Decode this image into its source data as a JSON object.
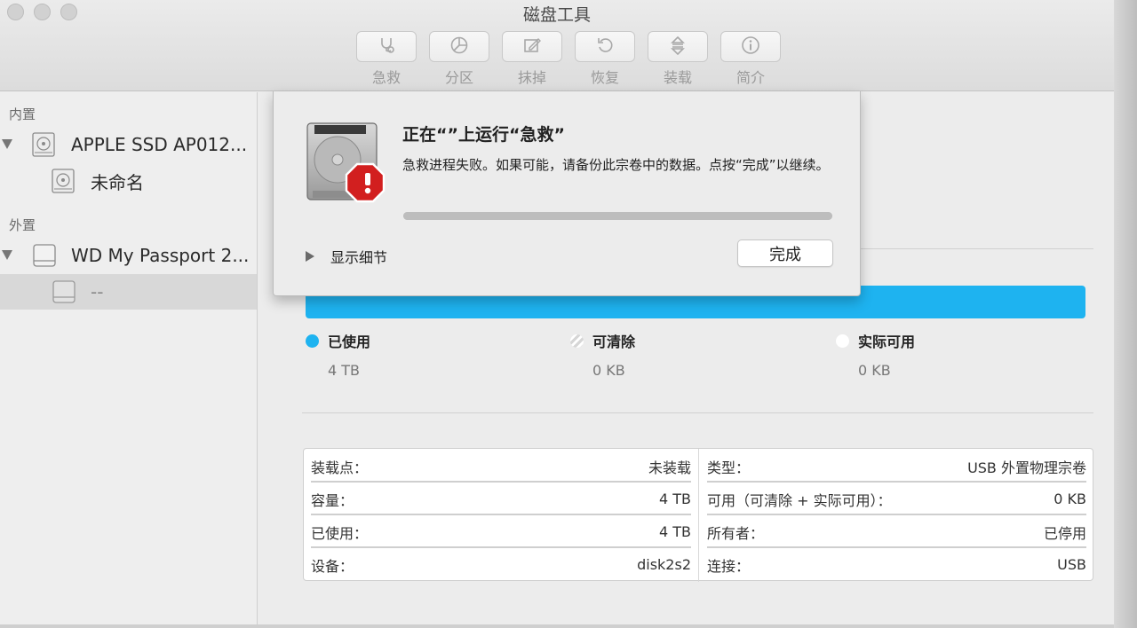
{
  "window": {
    "title": "磁盘工具"
  },
  "toolbar": {
    "items": [
      {
        "label": "急救",
        "icon": "stethoscope-icon"
      },
      {
        "label": "分区",
        "icon": "pie-chart-icon"
      },
      {
        "label": "抹掉",
        "icon": "erase-icon"
      },
      {
        "label": "恢复",
        "icon": "restore-icon"
      },
      {
        "label": "装载",
        "icon": "mount-icon"
      },
      {
        "label": "简介",
        "icon": "info-icon"
      }
    ]
  },
  "sidebar": {
    "internal_header": "内置",
    "internal_disk": "APPLE SSD AP012...",
    "internal_volume": "未命名",
    "external_header": "外置",
    "external_disk": "WD My Passport 2...",
    "external_volume": "--"
  },
  "usage": {
    "used_color": "#1eb3f0",
    "legend": [
      {
        "label": "已使用",
        "value": "4 TB",
        "color": "#1eb3f0"
      },
      {
        "label": "可清除",
        "value": "0 KB",
        "color": "#e8e8e8"
      },
      {
        "label": "实际可用",
        "value": "0 KB",
        "color": "#ffffff"
      }
    ]
  },
  "info": {
    "left": [
      {
        "key": "装载点：",
        "value": "未装载"
      },
      {
        "key": "容量：",
        "value": "4 TB"
      },
      {
        "key": "已使用：",
        "value": "4 TB"
      },
      {
        "key": "设备：",
        "value": "disk2s2"
      }
    ],
    "right": [
      {
        "key": "类型：",
        "value": "USB 外置物理宗卷"
      },
      {
        "key": "可用（可清除 + 实际可用）：",
        "value": "0 KB"
      },
      {
        "key": "所有者：",
        "value": "已停用"
      },
      {
        "key": "连接：",
        "value": "USB"
      }
    ]
  },
  "sheet": {
    "title": "正在“”上运行“急救”",
    "message": "急救进程失败。如果可能，请备份此宗卷中的数据。点按“完成”以继续。",
    "progress": 1.0,
    "show_details": "显示细节",
    "done_button": "完成"
  }
}
